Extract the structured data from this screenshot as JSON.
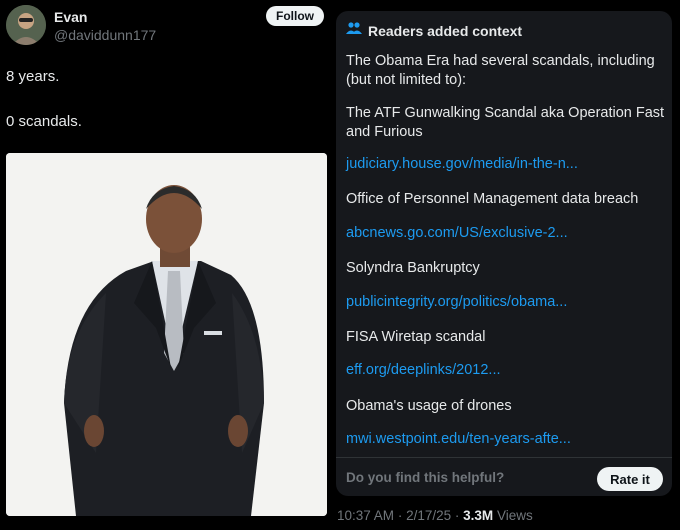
{
  "author": {
    "name": "Evan",
    "handle": "@daviddunn177",
    "follow_label": "Follow"
  },
  "tweet": {
    "line1": "8 years.",
    "line2": "0 scandals."
  },
  "context": {
    "title": "Readers added context",
    "intro": "The Obama Era had several scandals, including (but not limited to):",
    "items": [
      {
        "text": "The ATF Gunwalking Scandal aka Operation Fast and Furious",
        "link": "judiciary.house.gov/media/in-the-n..."
      },
      {
        "text": "Office of Personnel Management data breach",
        "link": "abcnews.go.com/US/exclusive-2..."
      },
      {
        "text": "Solyndra Bankruptcy",
        "link": "publicintegrity.org/politics/obama..."
      },
      {
        "text": "FISA Wiretap scandal",
        "link": "eff.org/deeplinks/2012..."
      },
      {
        "text": "Obama's usage of drones",
        "link": "mwi.westpoint.edu/ten-years-afte..."
      }
    ],
    "helpful_question": "Do you find this helpful?",
    "rate_label": "Rate it"
  },
  "meta": {
    "time": "10:37 AM",
    "separator": "·",
    "date": "2/17/25",
    "views_count": "3.3M",
    "views_label": "Views"
  },
  "icons": {
    "avatar": "avatar-photo",
    "context": "people-icon",
    "portrait": "portrait-photo"
  },
  "colors": {
    "background": "#000000",
    "panel": "#16181c",
    "link": "#1d9bf0",
    "muted": "#71767b",
    "text": "#e7e9ea"
  }
}
